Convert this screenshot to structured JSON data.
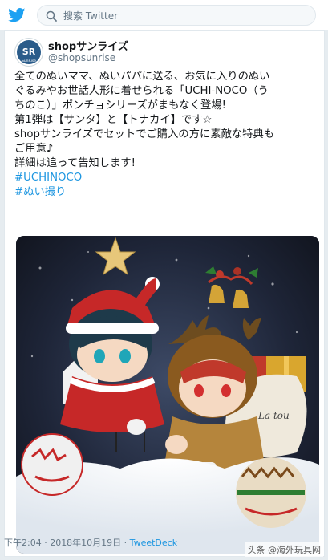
{
  "header": {
    "search_placeholder": "搜索 Twitter",
    "bird_icon": "twitter-bird-icon",
    "search_icon": "search-icon"
  },
  "tweet": {
    "display_name": "shopサンライズ",
    "handle": "@shopsunrise",
    "avatar_text": "SunRise",
    "avatar_label": "SR",
    "lines": [
      "全てのぬいママ、ぬいパパに送る、お気に入りのぬい",
      "ぐるみやお世話人形に着せられる「UCHI-NOCO（う",
      "ちのこ）」ポンチョシリーズがまもなく登場!",
      "第1弾は【サンタ】と【トナカイ】です☆",
      "shopサンライズでセットでご購入の方に素敵な特典も",
      "ご用意♪",
      "詳細は追って告知します!"
    ],
    "hashtags": [
      "#UCHINOCO",
      "#ぬい撮り"
    ],
    "photo_text": "La tou",
    "timestamp": "下午2:04 · 2018年10月19日 · ",
    "client": "TweetDeck"
  },
  "watermark": "头条 @海外玩具网",
  "colors": {
    "link": "#1b95e0",
    "brand": "#1da1f2",
    "muted": "#657786",
    "avatar_blue": "#2a5c8a"
  }
}
